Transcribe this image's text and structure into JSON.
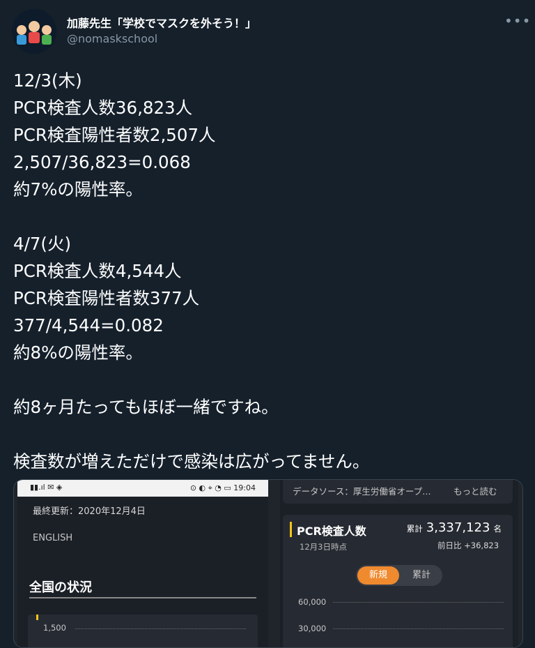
{
  "header": {
    "display_name": "加藤先生「学校でマスクを外そう！」",
    "handle": "@nomaskschool",
    "more_icon": "•••"
  },
  "tweet": {
    "lines": [
      "12/3(木)",
      "PCR検査人数36,823人",
      "PCR検査陽性者数2,507人",
      "2,507/36,823=0.068",
      "約7%の陽性率。",
      "",
      "4/7(火)",
      "PCR検査人数4,544人",
      "PCR検査陽性者数377人",
      "377/4,544=0.082",
      "約8%の陽性率。",
      "",
      "約8ヶ月たってもほぼ一緒ですね。",
      "",
      "検査数が増えただけで感染は広がってません。"
    ]
  },
  "screenshot_left": {
    "status_time": "19:04",
    "last_updated": "最終更新：2020年12月4日",
    "english_link": "ENGLISH",
    "section_title": "全国の状況",
    "tick": "1,500"
  },
  "screenshot_right": {
    "data_source": "データソース：厚生労働省オープ…",
    "read_more": "もっと読む",
    "pcr_title": "PCR検査人数",
    "cumulative_label": "累計",
    "cumulative_value": "3,337,123",
    "cumulative_unit": "名",
    "as_of": "12月3日時点",
    "prev_day": "前日比 +36,823",
    "toggle_new": "新規",
    "toggle_cumulative": "累計",
    "tick_top": "60,000",
    "tick_mid": "30,000"
  },
  "colors": {
    "background": "#15202b",
    "accent_orange": "#f08a2e",
    "marker_yellow": "#f5c518"
  }
}
